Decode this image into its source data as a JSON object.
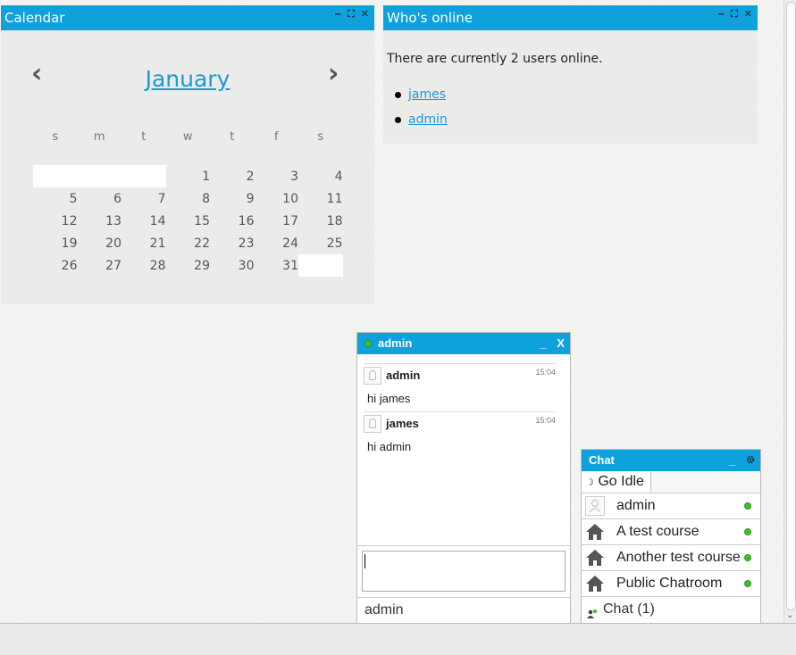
{
  "calendar": {
    "title": "Calendar",
    "month": "January",
    "weekdays": [
      "s",
      "m",
      "t",
      "w",
      "t",
      "f",
      "s"
    ],
    "weeks": [
      [
        "",
        "",
        "",
        "1",
        "2",
        "3",
        "4"
      ],
      [
        "5",
        "6",
        "7",
        "8",
        "9",
        "10",
        "11"
      ],
      [
        "12",
        "13",
        "14",
        "15",
        "16",
        "17",
        "18"
      ],
      [
        "19",
        "20",
        "21",
        "22",
        "23",
        "24",
        "25"
      ],
      [
        "26",
        "27",
        "28",
        "29",
        "30",
        "31",
        ""
      ]
    ],
    "prev_label": "‹",
    "next_label": "›"
  },
  "whos_online": {
    "title": "Who's online",
    "summary": "There are currently 2 users online.",
    "users": [
      "james",
      "admin"
    ]
  },
  "block_controls": [
    "‒",
    "⛶",
    "✕"
  ],
  "chat_window": {
    "title": "admin",
    "minimize": "_",
    "close": "X",
    "messages": [
      {
        "author": "admin",
        "time": "15:04",
        "text": "hi james"
      },
      {
        "author": "james",
        "time": "15:04",
        "text": "hi admin"
      }
    ],
    "input_value": "",
    "footer": "admin"
  },
  "chat_roster": {
    "title": "Chat",
    "minimize": "_",
    "settings_icon": "gear-icon",
    "idle_label": "Go Idle",
    "items": [
      {
        "label": "admin",
        "icon": "user-avatar-icon"
      },
      {
        "label": "A test course",
        "icon": "home-icon"
      },
      {
        "label": "Another test course",
        "icon": "home-icon"
      },
      {
        "label": "Public Chatroom",
        "icon": "home-icon"
      }
    ],
    "footer": "Chat (1)"
  },
  "colors": {
    "accent": "#0ea1dc",
    "link": "#1b9ad6",
    "online": "#3fbf2a",
    "block_bg": "#ebebe9"
  }
}
